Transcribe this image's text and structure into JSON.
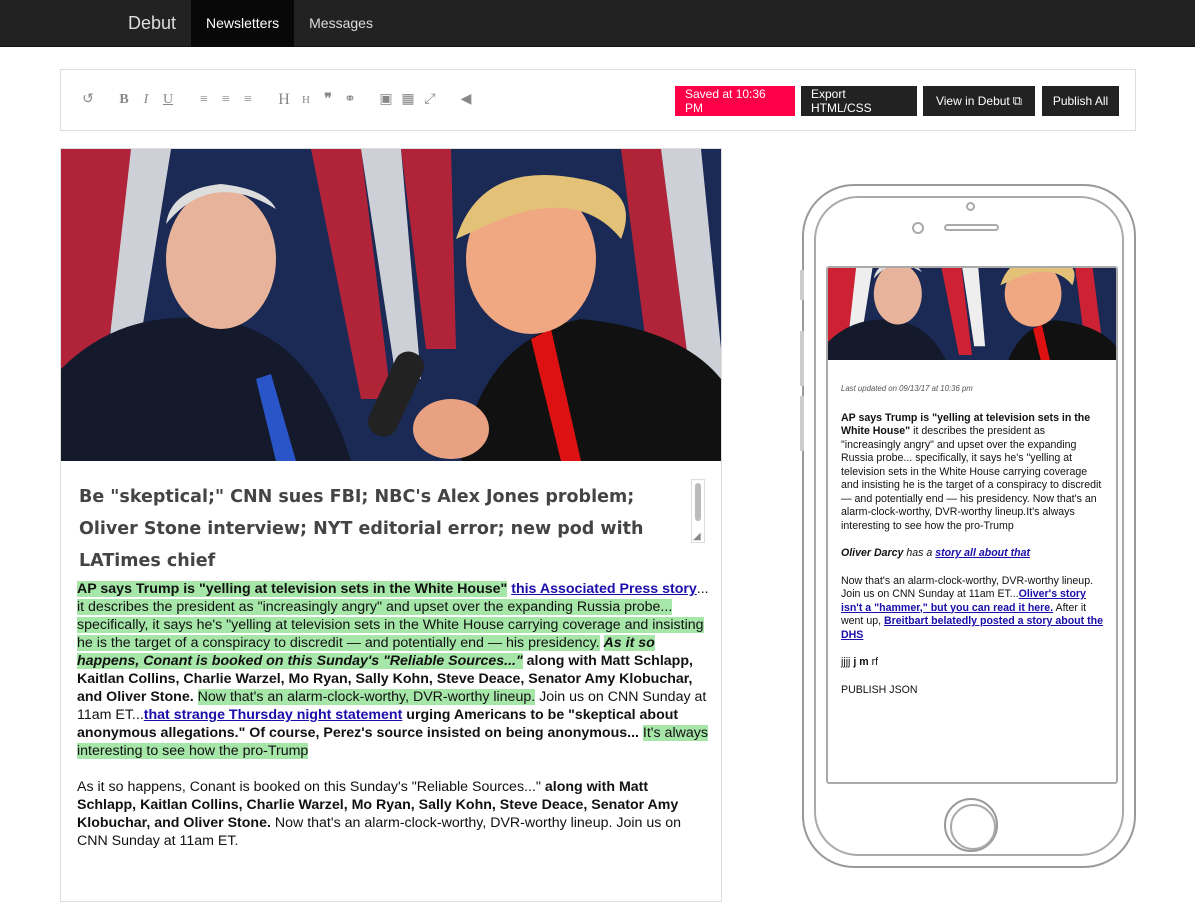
{
  "nav": {
    "brand": "Debut",
    "tabs": [
      {
        "label": "Newsletters"
      },
      {
        "label": "Messages"
      }
    ]
  },
  "toolbar": {
    "icons": [
      "undo-icon",
      "bold-icon",
      "italic-icon",
      "underline-icon",
      "align-left-icon",
      "align-center-icon",
      "align-right-icon",
      "heading-large-icon",
      "heading-small-icon",
      "quote-icon",
      "link-icon",
      "image-icon",
      "video-icon",
      "expand-icon",
      "megaphone-icon"
    ],
    "saved_label": "Saved at 10:36 PM",
    "export_label": "Export HTML/CSS",
    "view_label": "View in Debut",
    "publish_label": "Publish All"
  },
  "editor": {
    "title": "Be \"skeptical;\" CNN sues FBI; NBC's Alex Jones problem; Oliver Stone interview; NYT editorial error; new pod with LATimes chief",
    "p1": {
      "s1": "AP says Trump is \"yelling at television sets in the White House\"",
      "l1": "this Associated Press story",
      "s2": "...",
      "s3": "it describes the president as \"increasingly angry\" and upset over the expanding Russia probe... specifically, it says he's \"yelling at television sets in the White House carrying coverage and insisting he is the target of a conspiracy to discredit — and potentially end — his presidency.",
      "s4": "As it so happens, Conant is booked on this Sunday's \"Reliable Sources...\"",
      "s5": "along with Matt Schlapp, Kaitlan Collins, Charlie Warzel, Mo Ryan, Sally Kohn, Steve Deace, Senator Amy Klobuchar, and Oliver Stone.",
      "s6": "Now that's an alarm-clock-worthy, DVR-worthy lineup.",
      "s7": "Join us on CNN Sunday at 11am ET...",
      "l2": "that strange Thursday night statement",
      "s8": "urging Americans to be \"skeptical about anonymous allegations.\" Of course, Perez's source insisted on being anonymous...",
      "s9": "It's always interesting to see how the pro-Trump"
    },
    "p2": {
      "s1": "As it so happens, Conant is booked on this Sunday's \"Reliable Sources...\"",
      "s2": "along with Matt Schlapp, Kaitlan Collins, Charlie Warzel, Mo Ryan, Sally Kohn, Steve Deace, Senator Amy Klobuchar, and Oliver Stone.",
      "s3": "Now that's an alarm-clock-worthy, DVR-worthy lineup. Join us on CNN Sunday at 11am ET."
    }
  },
  "preview": {
    "updated": "Last updated on 09/13/17 at 10:36 pm",
    "p1_bold": "AP says Trump is \"yelling at television sets in the White House\"",
    "p1_rest": "it describes the president as \"increasingly angry\" and upset over the expanding Russia probe... specifically, it says he's \"yelling at television sets in the White House carrying coverage and insisting he is the target of a conspiracy to discredit — and potentially end — his presidency. Now that's an alarm-clock-worthy, DVR-worthy lineup.It's always interesting to see how the pro-Trump",
    "p2_author": "Oliver Darcy",
    "p2_mid": "has a",
    "p2_link": "story all about that",
    "p3_a": "Now that's an alarm-clock-worthy, DVR-worthy lineup. Join us on CNN Sunday at 11am ET...",
    "p3_link1": "Oliver's story isn't a \"hammer,\" but you can read it here.",
    "p3_b": "After it went up,",
    "p3_link2": "Breitbart belatedly posted a story about the DHS",
    "p4_a": "jjjj",
    "p4_b": "j m",
    "p4_c": "rf",
    "p5": "PUBLISH JSON"
  }
}
